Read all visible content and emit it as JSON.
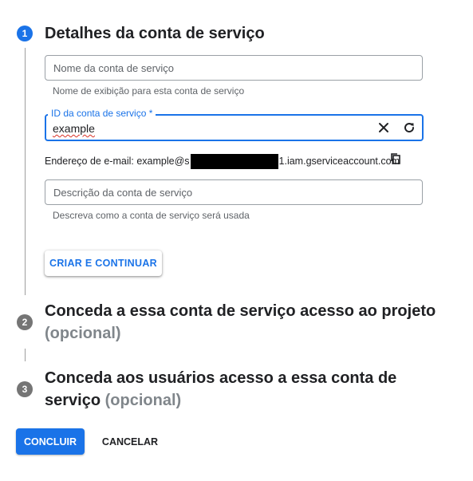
{
  "step1": {
    "number": "1",
    "title": "Detalhes da conta de serviço",
    "name_field": {
      "placeholder": "Nome da conta de serviço",
      "hint": "Nome de exibição para esta conta de serviço"
    },
    "id_field": {
      "label": "ID da conta de serviço *",
      "value": "example"
    },
    "email": {
      "prefix": "Endereço de e-mail: example@s",
      "suffix": "1.iam.gserviceaccount.com"
    },
    "description_field": {
      "placeholder": "Descrição da conta de serviço",
      "hint": "Descreva como a conta de serviço será usada"
    },
    "create_button": "CRIAR E CONTINUAR"
  },
  "step2": {
    "number": "2",
    "title": "Conceda a essa conta de serviço acesso ao projeto",
    "optional": "(opcional)"
  },
  "step3": {
    "number": "3",
    "title_line1": "Conceda aos usuários acesso a essa conta de",
    "title_line2": "serviço",
    "optional": "(opcional)"
  },
  "footer": {
    "done_button": "CONCLUIR",
    "cancel_button": "CANCELAR"
  },
  "colors": {
    "accent": "#1a73e8",
    "inactive_step": "#757575",
    "error_underline": "#d93025"
  }
}
